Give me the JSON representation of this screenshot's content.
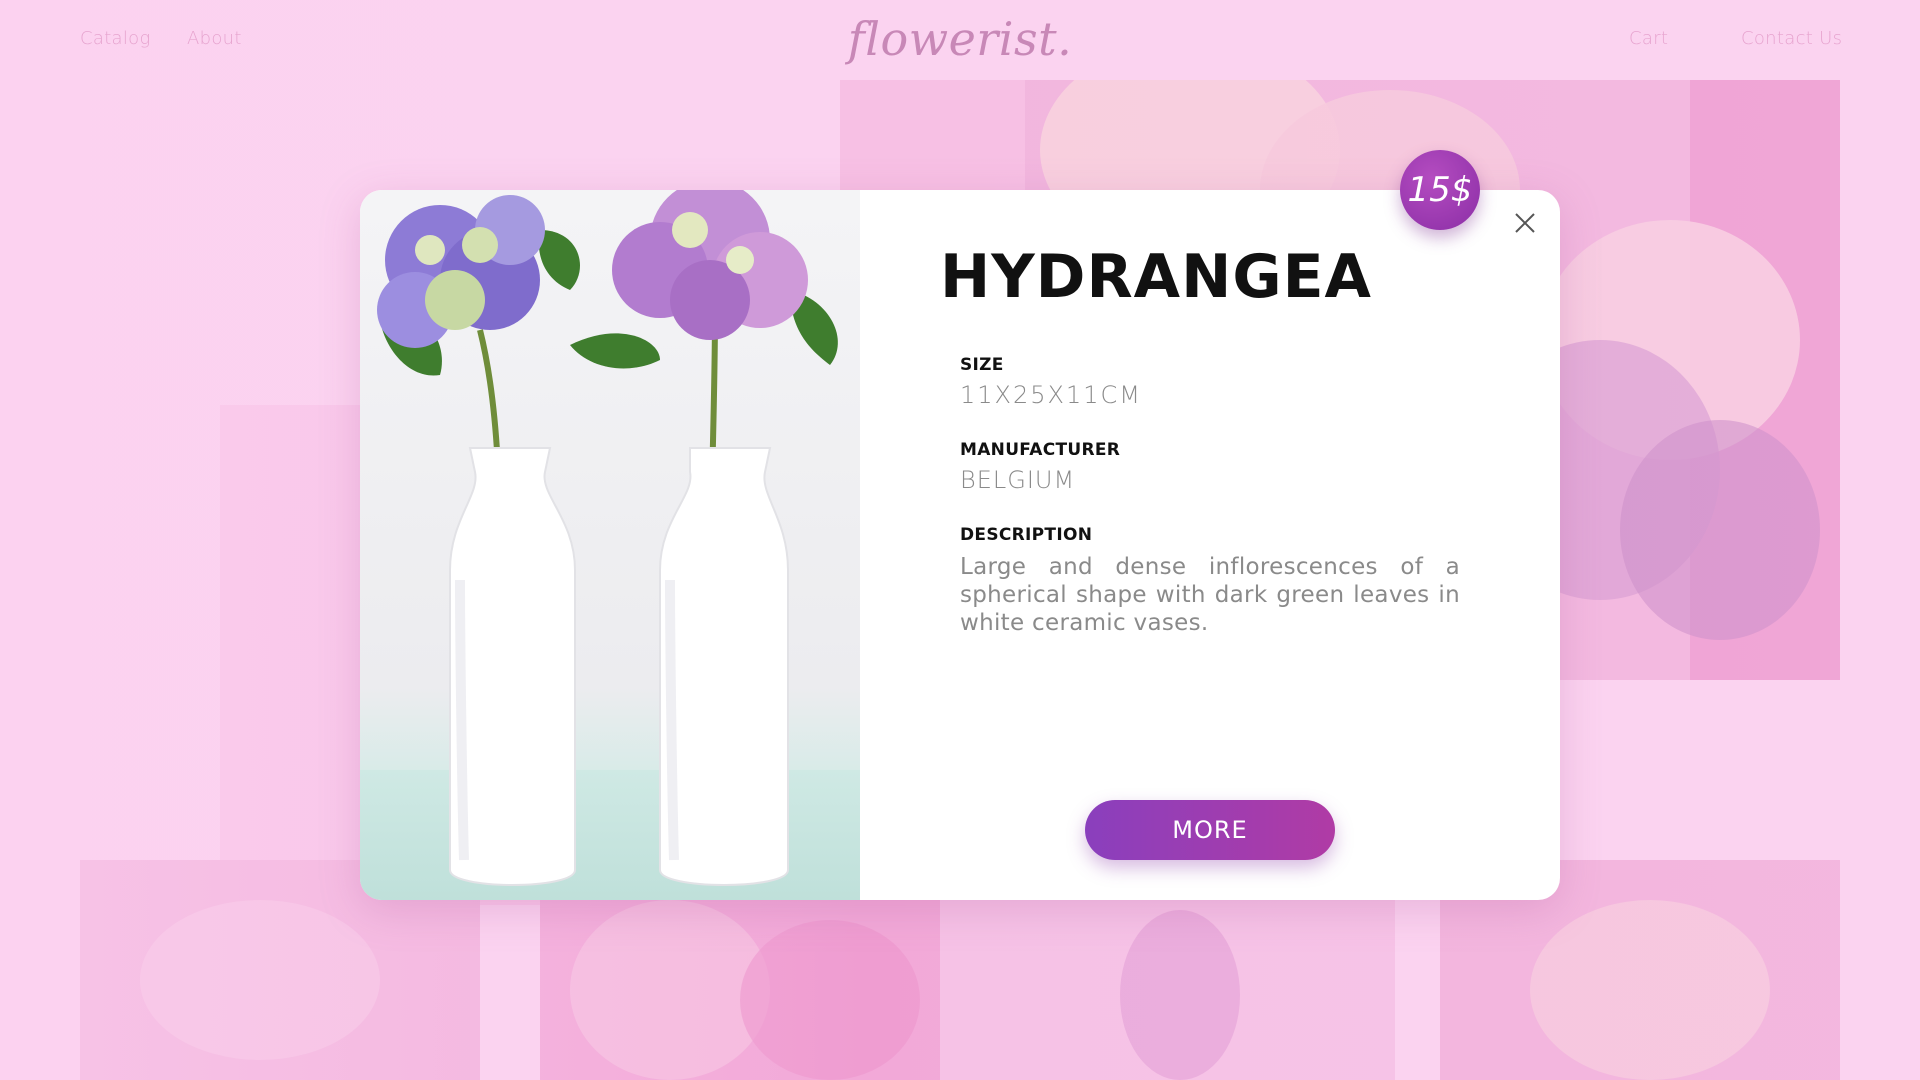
{
  "header": {
    "nav_left": [
      "Catalog",
      "About"
    ],
    "logo": "flowerist.",
    "nav_right": [
      "Cart",
      "Contact Us"
    ]
  },
  "product": {
    "name": "HYDRANGEA",
    "price": "15$",
    "size_label": "SIZE",
    "size_value": "11X25X11CM",
    "manufacturer_label": "MANUFACTURER",
    "manufacturer_value": "BELGIUM",
    "description_label": "DESCRIPTION",
    "description_value": "Large and dense inflorescences of a spherical shape with dark green leaves in white ceramic vases.",
    "more_label": "MORE"
  },
  "colors": {
    "background": "#fbd3f0",
    "accent_start": "#8a3fbd",
    "accent_end": "#b03ba5",
    "logo": "#c888b7",
    "nav": "#e7a4cf"
  },
  "icons": {
    "close": "close-icon"
  }
}
